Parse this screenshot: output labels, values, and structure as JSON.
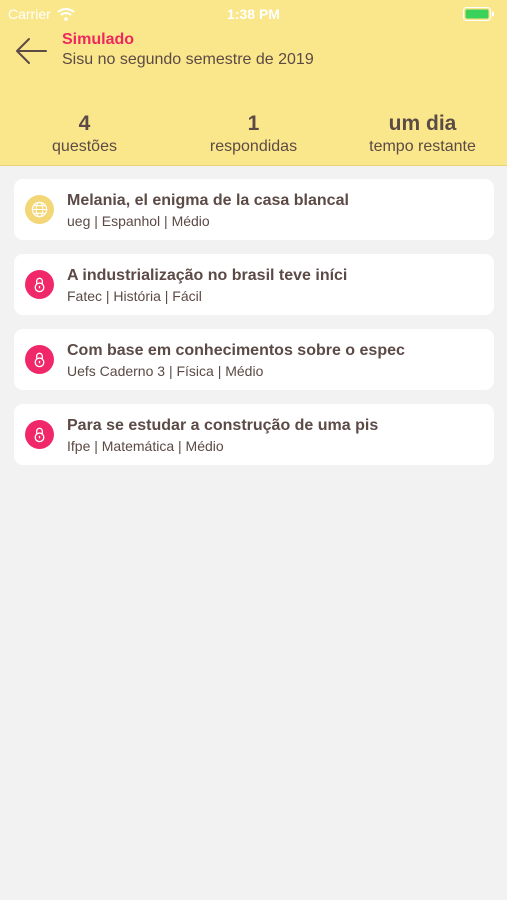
{
  "status_bar": {
    "carrier": "Carrier",
    "time": "1:38 PM",
    "wifi_icon": "wifi-icon",
    "battery_icon": "battery-icon",
    "battery_color": "#3cd15a"
  },
  "header": {
    "background": "#fae78b",
    "title": "Simulado",
    "title_color": "#f0275f",
    "subtitle": "Sisu no segundo semestre de 2019",
    "back_icon": "arrow-left-icon"
  },
  "stats": [
    {
      "value": "4",
      "label": "questões"
    },
    {
      "value": "1",
      "label": "respondidas"
    },
    {
      "value": "um dia",
      "label": "tempo restante"
    }
  ],
  "questions": [
    {
      "icon": "globe-icon",
      "icon_color": "#f3d676",
      "title": "Melania, el enigma de la casa blancal",
      "meta": "ueg | Espanhol | Médio"
    },
    {
      "icon": "lock-icon",
      "icon_color": "#f0286a",
      "title": "A industrialização no brasil teve iníci",
      "meta": "Fatec | História | Fácil"
    },
    {
      "icon": "lock-icon",
      "icon_color": "#f0286a",
      "title": "Com base em conhecimentos sobre o espec",
      "meta": "Uefs Caderno 3 | Física | Médio"
    },
    {
      "icon": "lock-icon",
      "icon_color": "#f0286a",
      "title": "Para se estudar a construção de uma pis",
      "meta": "Ifpe | Matemática | Médio"
    }
  ]
}
